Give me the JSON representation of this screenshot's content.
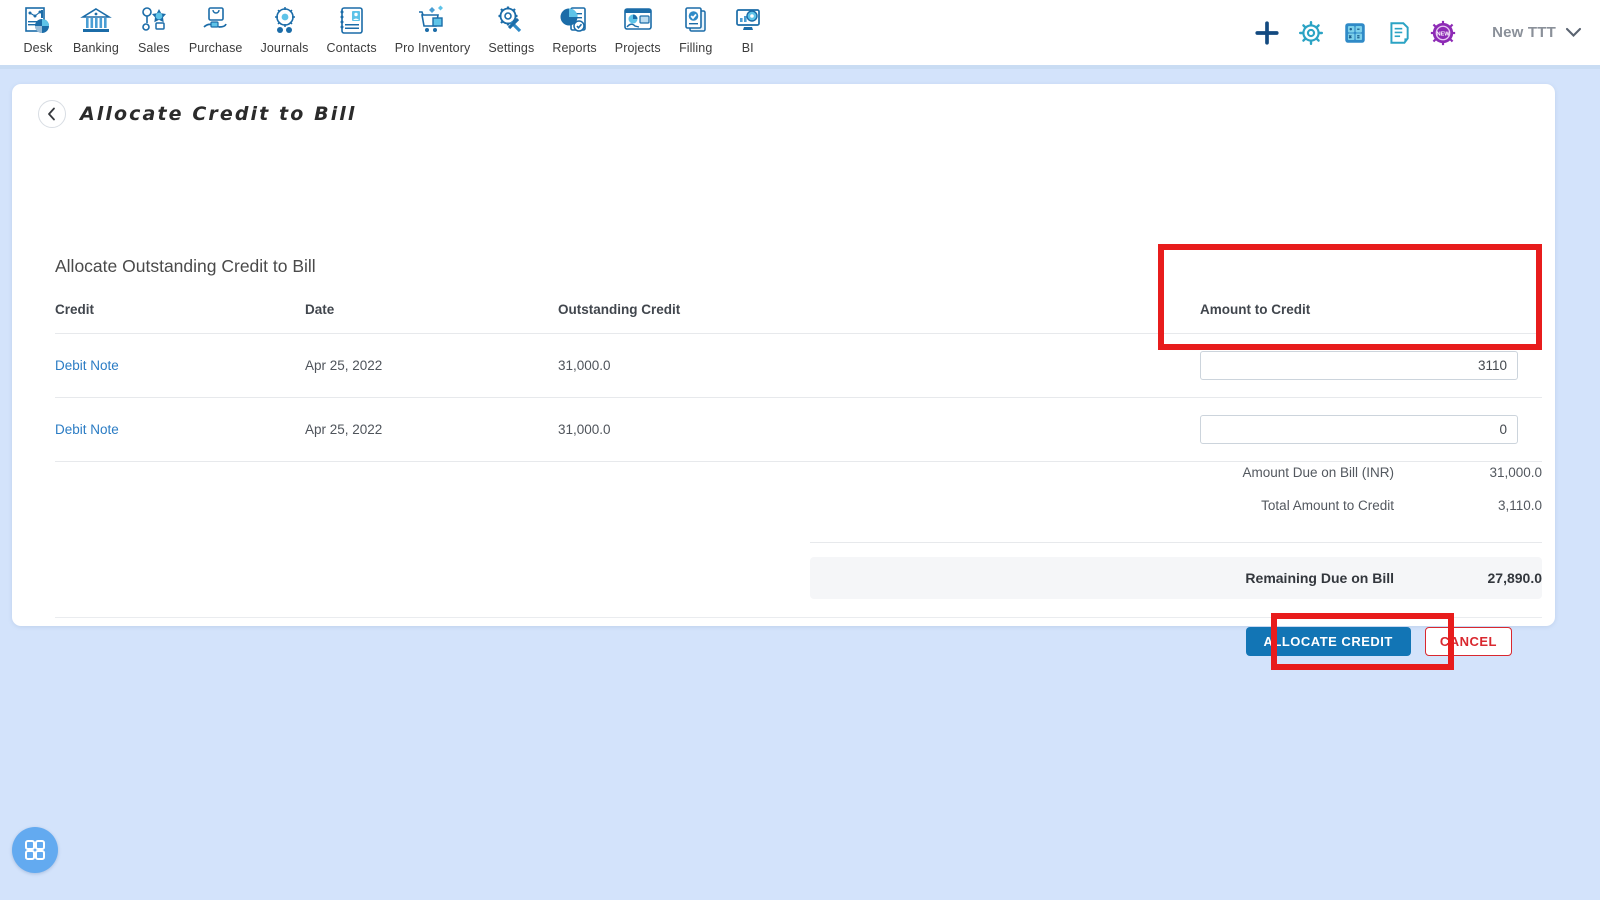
{
  "topnav": {
    "modules": [
      {
        "label": "Desk",
        "icon": "dashboard-icon"
      },
      {
        "label": "Banking",
        "icon": "bank-icon"
      },
      {
        "label": "Sales",
        "icon": "sales-icon"
      },
      {
        "label": "Purchase",
        "icon": "purchase-icon"
      },
      {
        "label": "Journals",
        "icon": "journals-icon"
      },
      {
        "label": "Contacts",
        "icon": "contacts-icon"
      },
      {
        "label": "Pro Inventory",
        "icon": "inventory-icon"
      },
      {
        "label": "Settings",
        "icon": "settings-icon"
      },
      {
        "label": "Reports",
        "icon": "reports-icon"
      },
      {
        "label": "Projects",
        "icon": "projects-icon"
      },
      {
        "label": "Filling",
        "icon": "filing-icon"
      },
      {
        "label": "BI",
        "icon": "bi-icon"
      }
    ],
    "tools": [
      {
        "name": "add-icon"
      },
      {
        "name": "gear-icon"
      },
      {
        "name": "calculator-icon"
      },
      {
        "name": "notes-icon"
      },
      {
        "name": "new-badge-icon"
      }
    ],
    "organization": "New TTT"
  },
  "page": {
    "title": "Allocate Credit to Bill",
    "back_icon": "chevron-left-icon",
    "section_title": "Allocate Outstanding Credit to Bill"
  },
  "table": {
    "headers": {
      "credit": "Credit",
      "date": "Date",
      "outstanding": "Outstanding Credit",
      "amount": "Amount to Credit"
    },
    "rows": [
      {
        "credit": "Debit Note",
        "date": "Apr 25, 2022",
        "outstanding": "31,000.0",
        "amount": "3110"
      },
      {
        "credit": "Debit Note",
        "date": "Apr 25, 2022",
        "outstanding": "31,000.0",
        "amount": "0"
      }
    ],
    "amount_placeholder": ""
  },
  "summary": {
    "amount_due_label": "Amount Due on Bill (INR)",
    "amount_due_value": "31,000.0",
    "total_credit_label": "Total Amount to Credit",
    "total_credit_value": "3,110.0",
    "remaining_label": "Remaining Due on Bill",
    "remaining_value": "27,890.0"
  },
  "footer": {
    "allocate_label": "ALLOCATE CREDIT",
    "cancel_label": "CANCEL"
  },
  "fab": {
    "icon": "apps-grid-icon"
  },
  "colors": {
    "page_background": "#d3e3fb",
    "card_background": "#ffffff",
    "primary_button": "#1275b5",
    "cancel_red": "#d9282f",
    "highlight_red": "#e81c1c",
    "link_blue": "#2b7cc4",
    "icon_blue": "#1b6ca8",
    "fab_blue": "#63aaf0"
  }
}
